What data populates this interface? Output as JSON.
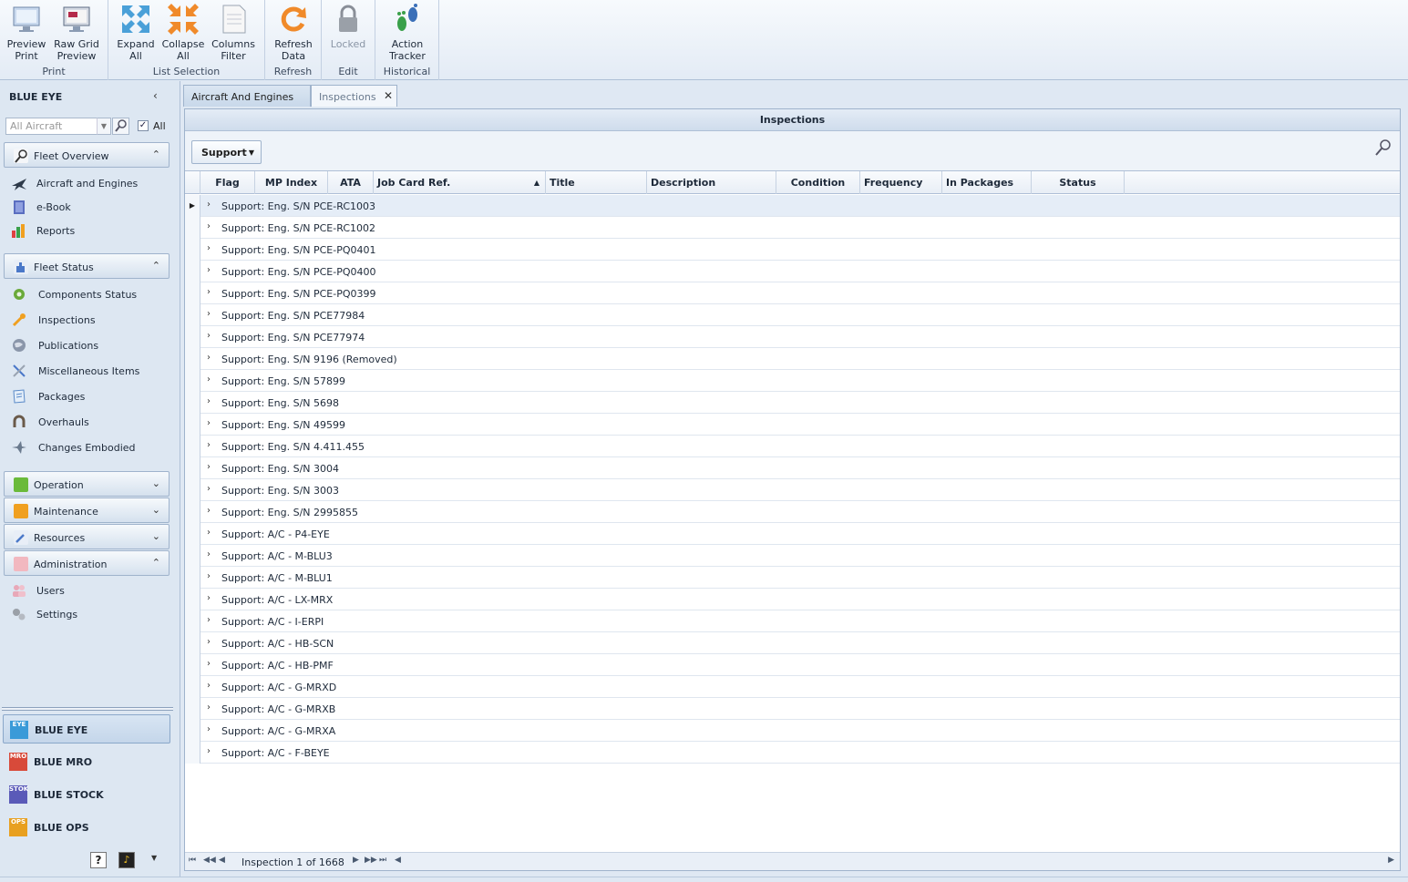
{
  "ribbon": {
    "groups": [
      {
        "label": "Print",
        "buttons": [
          "Preview\nPrint",
          "Raw Grid\nPreview"
        ]
      },
      {
        "label": "List Selection",
        "buttons": [
          "Expand\nAll",
          "Collapse\nAll",
          "Columns\nFilter"
        ]
      },
      {
        "label": "Refresh",
        "buttons": [
          "Refresh\nData"
        ]
      },
      {
        "label": "Edit",
        "buttons": [
          "Locked"
        ]
      },
      {
        "label": "Historical",
        "buttons": [
          "Action\nTracker"
        ]
      }
    ],
    "preview_print_l1": "Preview",
    "preview_print_l2": "Print",
    "raw_grid_l1": "Raw Grid",
    "raw_grid_l2": "Preview",
    "expand_l1": "Expand",
    "expand_l2": "All",
    "collapse_l1": "Collapse",
    "collapse_l2": "All",
    "columns_l1": "Columns",
    "columns_l2": "Filter",
    "refresh_l1": "Refresh",
    "refresh_l2": "Data",
    "locked": "Locked",
    "action_l1": "Action",
    "action_l2": "Tracker",
    "group_print": "Print",
    "group_list": "List Selection",
    "group_refresh": "Refresh",
    "group_edit": "Edit",
    "group_hist": "Historical"
  },
  "sidebar": {
    "title": "BLUE EYE",
    "collapse_glyph": "‹",
    "filter_placeholder": "All Aircraft",
    "all_checkbox": "All",
    "fleet_overview": {
      "label": "Fleet Overview",
      "items": [
        "Aircraft and Engines",
        "e-Book",
        "Reports"
      ]
    },
    "fleet_status": {
      "label": "Fleet Status",
      "items": [
        "Components Status",
        "Inspections",
        "Publications",
        "Miscellaneous Items",
        "Packages",
        "Overhauls",
        "Changes Embodied"
      ]
    },
    "operation": "Operation",
    "maintenance": "Maintenance",
    "resources": "Resources",
    "administration": {
      "label": "Administration",
      "items": [
        "Users",
        "Settings"
      ]
    },
    "apps": [
      "BLUE EYE",
      "BLUE MRO",
      "BLUE STOCK",
      "BLUE OPS"
    ],
    "app_icons": [
      "EYE",
      "MRO",
      "STOK",
      "OPS"
    ],
    "help": "?"
  },
  "tabs": [
    {
      "label": "Aircraft And Engines"
    },
    {
      "label": "Inspections"
    }
  ],
  "panel": {
    "title": "Inspections",
    "filter_button": "Support",
    "columns": [
      "Flag",
      "MP Index",
      "ATA",
      "Job Card Ref.",
      "Title",
      "Description",
      "Condition",
      "Frequency",
      "In Packages",
      "Status"
    ],
    "rows": [
      "Support: Eng. S/N PCE-RC1003",
      "Support: Eng. S/N PCE-RC1002",
      "Support: Eng. S/N PCE-PQ0401",
      "Support: Eng. S/N PCE-PQ0400",
      "Support: Eng. S/N PCE-PQ0399",
      "Support: Eng. S/N PCE77984",
      "Support: Eng. S/N PCE77974",
      "Support: Eng. S/N 9196 (Removed)",
      "Support: Eng. S/N 57899",
      "Support: Eng. S/N 5698",
      "Support: Eng. S/N 49599",
      "Support: Eng. S/N 4.411.455",
      "Support: Eng. S/N 3004",
      "Support: Eng. S/N 3003",
      "Support: Eng. S/N 2995855",
      "Support: A/C - P4-EYE",
      "Support: A/C - M-BLU3",
      "Support: A/C - M-BLU1",
      "Support: A/C - LX-MRX",
      "Support: A/C - I-ERPI",
      "Support: A/C - HB-SCN",
      "Support: A/C - HB-PMF",
      "Support: A/C - G-MRXD",
      "Support: A/C - G-MRXB",
      "Support: A/C - G-MRXA",
      "Support: A/C - F-BEYE"
    ],
    "pager_text": "Inspection 1 of 1668"
  }
}
